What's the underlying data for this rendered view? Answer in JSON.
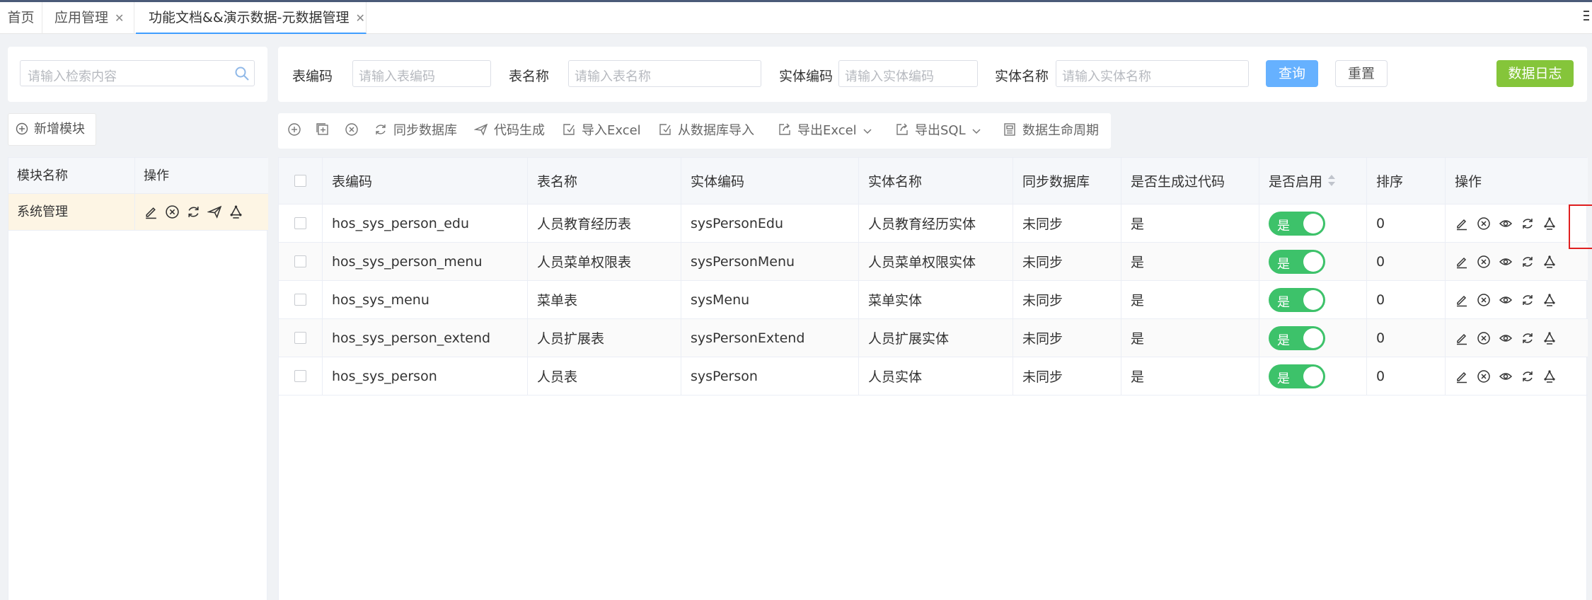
{
  "tabs": [
    {
      "label": "首页",
      "closable": false
    },
    {
      "label": "应用管理",
      "closable": true
    },
    {
      "label": "功能文档&&演示数据-元数据管理",
      "closable": true,
      "active": true
    }
  ],
  "close_glyph": "✕",
  "left_search": {
    "placeholder": "请输入检索内容",
    "icon": "search-icon"
  },
  "add_module": {
    "label": "新增模块",
    "icon": "plus-circle-icon"
  },
  "module_table": {
    "headers": [
      "模块名称",
      "操作"
    ],
    "rows": [
      {
        "name": "系统管理",
        "icons": [
          "edit-icon",
          "delete-icon",
          "refresh-icon",
          "send-icon",
          "recycle-icon"
        ]
      }
    ]
  },
  "filters": {
    "table_code": {
      "label": "表编码",
      "placeholder": "请输入表编码"
    },
    "table_name": {
      "label": "表名称",
      "placeholder": "请输入表名称"
    },
    "entity_code": {
      "label": "实体编码",
      "placeholder": "请输入实体编码"
    },
    "entity_name": {
      "label": "实体名称",
      "placeholder": "请输入实体名称"
    },
    "query_label": "查询",
    "reset_label": "重置",
    "log_label": "数据日志"
  },
  "toolbar": {
    "items": [
      {
        "label": "",
        "icon": "plus-circle-icon"
      },
      {
        "label": "",
        "icon": "copy-plus-icon"
      },
      {
        "label": "",
        "icon": "delete-icon"
      },
      {
        "label": "同步数据库",
        "icon": "refresh-icon"
      },
      {
        "label": "代码生成",
        "icon": "send-icon"
      },
      {
        "label": "导入Excel",
        "icon": "import-icon"
      },
      {
        "label": "从数据库导入",
        "icon": "import-icon"
      },
      {
        "label": "导出Excel",
        "icon": "export-icon",
        "dropdown": true
      },
      {
        "label": "导出SQL",
        "icon": "export-icon",
        "dropdown": true
      },
      {
        "label": "数据生命周期",
        "icon": "lifecycle-icon"
      }
    ]
  },
  "main_table": {
    "headers": [
      "表编码",
      "表名称",
      "实体编码",
      "实体名称",
      "同步数据库",
      "是否生成过代码",
      "是否启用",
      "排序",
      "操作"
    ],
    "rows": [
      {
        "code": "hos_sys_person_edu",
        "name": "人员教育经历表",
        "entity_code": "sysPersonEdu",
        "entity_name": "人员教育经历实体",
        "sync": "未同步",
        "generated": "是",
        "enabled": "是",
        "sort": "0"
      },
      {
        "code": "hos_sys_person_menu",
        "name": "人员菜单权限表",
        "entity_code": "sysPersonMenu",
        "entity_name": "人员菜单权限实体",
        "sync": "未同步",
        "generated": "是",
        "enabled": "是",
        "sort": "0"
      },
      {
        "code": "hos_sys_menu",
        "name": "菜单表",
        "entity_code": "sysMenu",
        "entity_name": "菜单实体",
        "sync": "未同步",
        "generated": "是",
        "enabled": "是",
        "sort": "0"
      },
      {
        "code": "hos_sys_person_extend",
        "name": "人员扩展表",
        "entity_code": "sysPersonExtend",
        "entity_name": "人员扩展实体",
        "sync": "未同步",
        "generated": "是",
        "enabled": "是",
        "sort": "0"
      },
      {
        "code": "hos_sys_person",
        "name": "人员表",
        "entity_code": "sysPerson",
        "entity_name": "人员实体",
        "sync": "未同步",
        "generated": "是",
        "enabled": "是",
        "sort": "0"
      }
    ],
    "row_icons": [
      "edit-icon",
      "delete-icon",
      "view-icon",
      "refresh-icon",
      "recycle-icon"
    ]
  },
  "colors": {
    "accent": "#409eff",
    "switch_on": "#3dc26a",
    "log_button": "#85c53a",
    "highlight": "#e02020",
    "selected_row": "#fdf5e4"
  }
}
